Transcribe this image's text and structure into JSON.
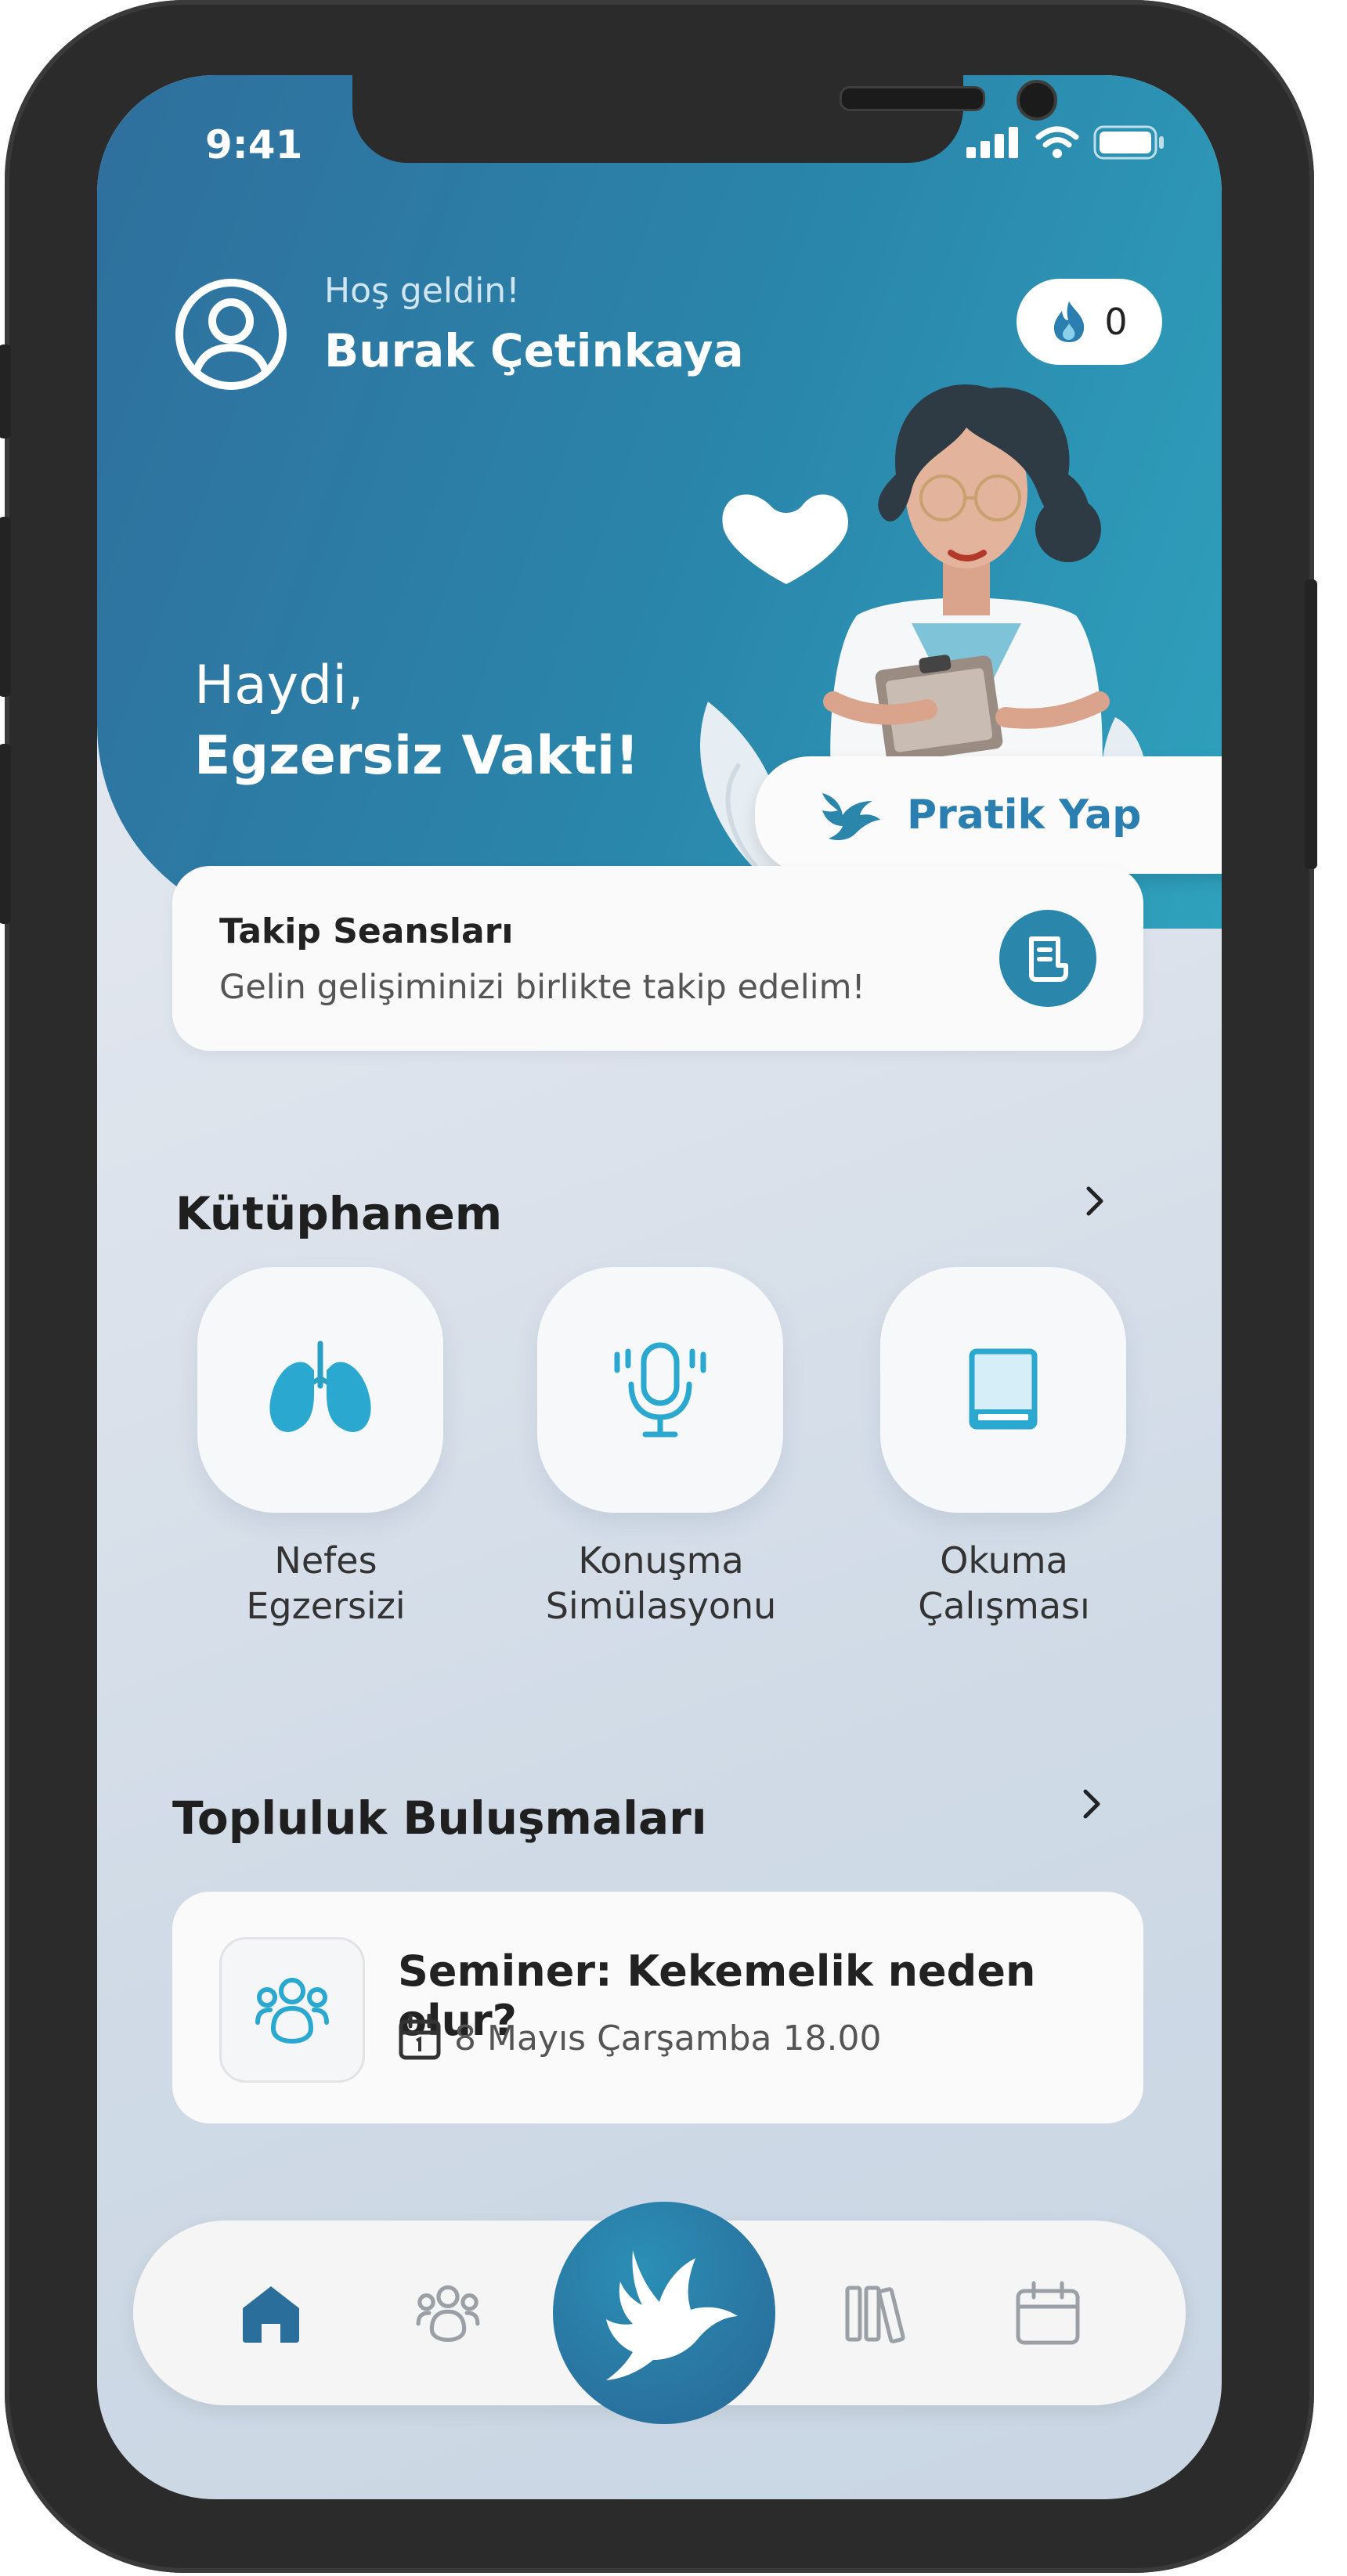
{
  "status_bar": {
    "time": "9:41"
  },
  "header": {
    "greeting": "Hoş geldin!",
    "user_name": "Burak Çetinkaya",
    "streak_count": "0"
  },
  "hero": {
    "line1": "Haydi,",
    "line2": "Egzersiz Vakti!",
    "practice_button": "Pratik Yap"
  },
  "follow_up": {
    "title": "Takip Seansları",
    "subtitle": "Gelin gelişiminizi birlikte takip edelim!"
  },
  "library": {
    "title": "Kütüphanem",
    "items": [
      {
        "label_line1": "Nefes",
        "label_line2": "Egzersizi",
        "icon": "lungs-icon"
      },
      {
        "label_line1": "Konuşma",
        "label_line2": "Simülasyonu",
        "icon": "microphone-icon"
      },
      {
        "label_line1": "Okuma",
        "label_line2": "Çalışması",
        "icon": "book-icon"
      }
    ]
  },
  "community": {
    "title": "Topluluk Buluşmaları",
    "event": {
      "title": "Seminer: Kekemelik neden olur?",
      "date": "8 Mayıs Çarşamba 18.00"
    }
  },
  "bottom_nav": {
    "items": [
      "home-icon",
      "community-icon",
      "bird-logo-icon",
      "library-icon",
      "calendar-icon"
    ]
  },
  "colors": {
    "primary": "#2a86ab",
    "dark_blue": "#2f6f9d",
    "accent_fire": "#2a7fb0"
  }
}
